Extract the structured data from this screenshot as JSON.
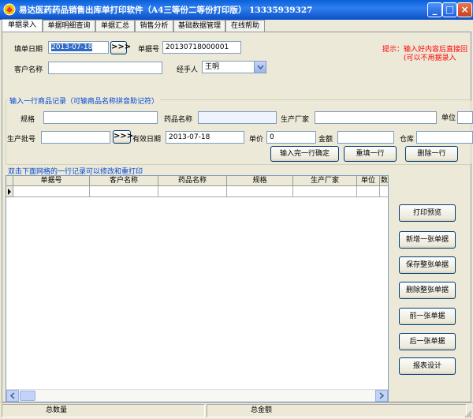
{
  "window": {
    "title": "易达医药药品销售出库单打印软件（A4三等份二等份打印版） 13335939327",
    "min_label": "_",
    "max_label": "□",
    "close_label": "×"
  },
  "tabs": [
    {
      "label": "单据录入",
      "active": true
    },
    {
      "label": "单据明细查询"
    },
    {
      "label": "单据汇总"
    },
    {
      "label": "销售分析"
    },
    {
      "label": "基础数据管理"
    },
    {
      "label": "在线帮助"
    }
  ],
  "form": {
    "fill_date_label": "填单日期",
    "fill_date_value": "2013-07-18",
    "picker_label": ">>>",
    "doc_no_label": "单据号",
    "doc_no_value": "20130718000001",
    "customer_label": "客户名称",
    "customer_value": "",
    "handler_label": "经手人",
    "handler_value": "王明",
    "tip_line1": "提示：输入好内容后直接回",
    "tip_line2": "(可以不用据录入"
  },
  "item_group": {
    "title": "输入一行商品记录（可输商品名称拼音助记符）",
    "spec_label": "规格",
    "drug_name_label": "药品名称",
    "maker_label": "生产厂家",
    "unit_label": "单位",
    "batch_label": "生产批号",
    "batch_picker_label": ">>>",
    "expiry_label": "有效日期",
    "expiry_value": "2013-07-18",
    "price_label": "单价",
    "price_value": "0",
    "amount_label": "金额",
    "warehouse_label": "仓库",
    "confirm_button": "输入完一行确定",
    "refill_button": "重填一行",
    "delete_button": "删除一行"
  },
  "grid": {
    "hint": "双击下面网格的一行记录可以修改和重打印",
    "columns": [
      "单据号",
      "客户名称",
      "药品名称",
      "规格",
      "生产厂家",
      "单位",
      "数"
    ]
  },
  "side_buttons": [
    {
      "key": "print_preview",
      "label": "打印预览"
    },
    {
      "key": "new_doc",
      "label": "新增一张单据"
    },
    {
      "key": "save_doc",
      "label": "保存整张单据"
    },
    {
      "key": "delete_doc",
      "label": "删除整张单据"
    },
    {
      "key": "prev_doc",
      "label": "前一张单据"
    },
    {
      "key": "next_doc",
      "label": "后一张单据"
    },
    {
      "key": "report_design",
      "label": "报表设计"
    }
  ],
  "status": {
    "total_qty_label": "总数量",
    "total_amount_label": "总金额"
  },
  "colors": {
    "titlebar": "#0a5fd8",
    "tip_red": "#ff0000",
    "group_title_blue": "#0046d5",
    "selection_blue": "#316ac5"
  }
}
